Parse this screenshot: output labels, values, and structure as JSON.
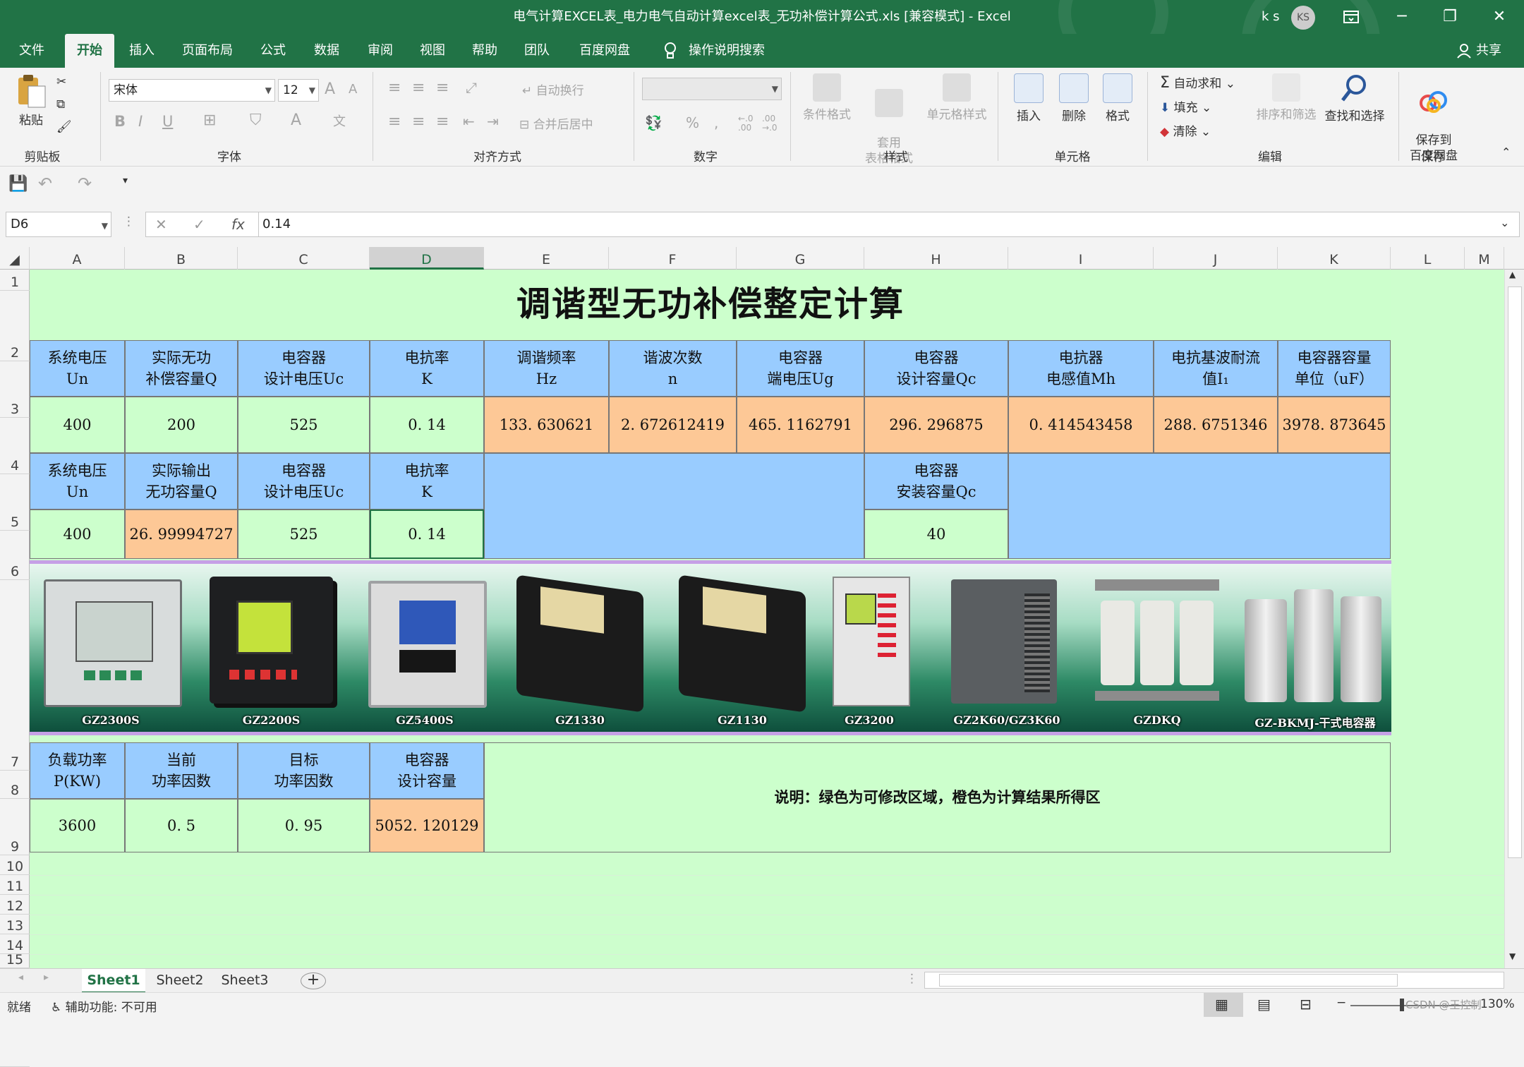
{
  "window": {
    "title": "电气计算EXCEL表_电力电气自动计算excel表_无功补偿计算公式.xls  [兼容模式]  -  Excel",
    "user": "k s",
    "avatar": "KS",
    "ribbon_display_icon": "ribbon-display-options-icon",
    "minimize_icon": "─",
    "restore_icon": "❐",
    "close_icon": "✕"
  },
  "menu": {
    "tabs": [
      "文件",
      "开始",
      "插入",
      "页面布局",
      "公式",
      "数据",
      "审阅",
      "视图",
      "帮助",
      "团队",
      "百度网盘"
    ],
    "active": "开始",
    "tellme": "操作说明搜索",
    "share": "共享"
  },
  "ribbon": {
    "clipboard": {
      "paste": "粘贴",
      "label": "剪贴板"
    },
    "font": {
      "name": "宋体",
      "size": "12",
      "bold": "B",
      "italic": "I",
      "underline": "U",
      "grow": "A",
      "shrink": "A",
      "fontcolor": "A",
      "label": "字体"
    },
    "alignment": {
      "wrap": "自动换行",
      "merge": "合并后居中",
      "label": "对齐方式"
    },
    "number": {
      "format": "",
      "percent": "%",
      "comma": ",",
      "inc": "←.0\n.00",
      "dec": ".00\n→.0",
      "label": "数字"
    },
    "styles": {
      "conditional": "条件格式",
      "table": "套用\n表格格式",
      "cell": "单元格样式",
      "label": "样式"
    },
    "cells": {
      "insert": "插入",
      "delete": "删除",
      "format": "格式",
      "label": "单元格"
    },
    "editing": {
      "autosum": "自动求和",
      "fill": "填充",
      "clear": "清除",
      "sort": "排序和筛选",
      "find": "查找和选择",
      "label": "编辑"
    },
    "save": {
      "save_to": "保存到\n百度网盘",
      "label": "保存"
    }
  },
  "formula": {
    "namebox": "D6",
    "value": "0.14",
    "cancel": "✕",
    "enter": "✓",
    "fx": "fx"
  },
  "columns": [
    "A",
    "B",
    "C",
    "D",
    "E",
    "F",
    "G",
    "H",
    "I",
    "J",
    "K",
    "L",
    "M"
  ],
  "selected_column": "D",
  "rows": [
    "1",
    "2",
    "3",
    "4",
    "5",
    "6",
    "7",
    "8",
    "9",
    "10",
    "11",
    "12",
    "13",
    "14",
    "15"
  ],
  "sheet": {
    "title": "调谐型无功补偿整定计算",
    "row3": [
      "系统电压\nUn",
      "实际无功\n补偿容量Q",
      "电容器\n设计电压Uc",
      "电抗率\nK",
      "调谐频率\nHz",
      "谐波次数\nn",
      "电容器\n端电压Ug",
      "电容器\n设计容量Qc",
      "电抗器\n电感值Mh",
      "电抗基波耐流\n值I₁",
      "电容器容量\n单位（uF）"
    ],
    "row4": [
      "400",
      "200",
      "525",
      "0. 14",
      "133. 630621",
      "2. 672612419",
      "465. 1162791",
      "296. 296875",
      "0. 414543458",
      "288. 6751346",
      "3978. 873645"
    ],
    "row5": [
      "系统电压\nUn",
      "实际输出\n无功容量Q",
      "电容器\n设计电压Uc",
      "电抗率\nK",
      "电容器\n安装容量Qc"
    ],
    "row6": [
      "400",
      "26. 99994727",
      "525",
      "0. 14",
      "40"
    ],
    "row8": [
      "负载功率\nP(KW)",
      "当前\n功率因数",
      "目标\n功率因数",
      "电容器\n设计容量"
    ],
    "row9": [
      "3600",
      "0. 5",
      "0. 95",
      "5052. 120129"
    ],
    "note": "说明：绿色为可修改区域，橙色为计算结果所得区",
    "products": [
      "GZ2300S",
      "GZ2200S",
      "GZ5400S",
      "GZ1330",
      "GZ1130",
      "GZ3200",
      "GZ2K60/GZ3K60",
      "GZDKQ",
      "GZ-BKMJ-干式电容器"
    ]
  },
  "tabs": {
    "sheets": [
      "Sheet1",
      "Sheet2",
      "Sheet3"
    ],
    "active": "Sheet1",
    "add": "+"
  },
  "status": {
    "ready": "就绪",
    "accessibility": "辅助功能: 不可用",
    "zoom": "130%",
    "watermark": "CSDN @王控制"
  },
  "colors": {
    "excel_green": "#217346",
    "input_green": "#ccffcc",
    "result_orange": "#fdc896",
    "header_blue": "#99ccff"
  }
}
